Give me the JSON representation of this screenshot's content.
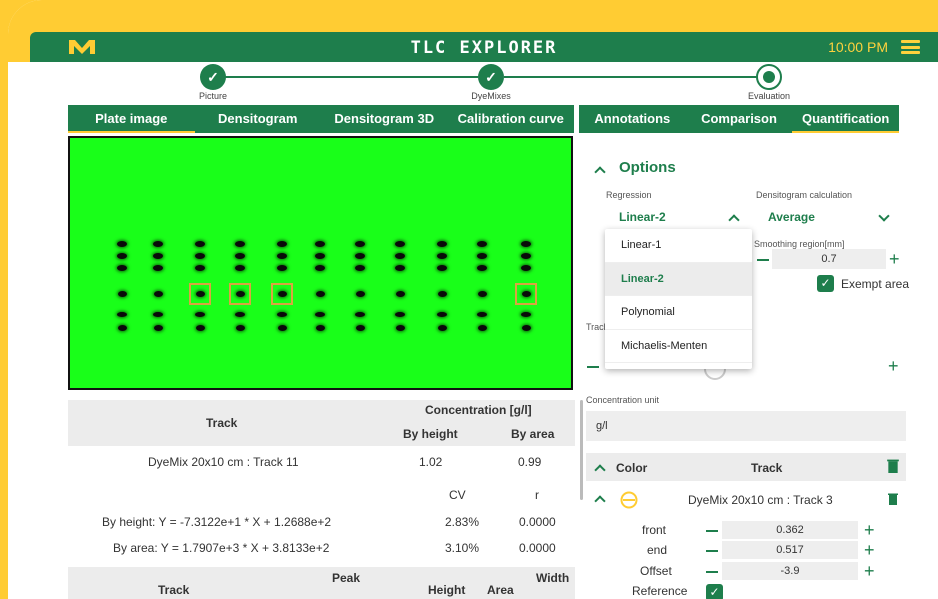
{
  "app": {
    "title": "TLC EXPLORER",
    "time": "10:00 PM"
  },
  "stepper": [
    {
      "label": "Picture",
      "state": "done"
    },
    {
      "label": "DyeMixes",
      "state": "done"
    },
    {
      "label": "Evaluation",
      "state": "current"
    }
  ],
  "left_tabs": [
    "Plate image",
    "Densitogram",
    "Densitogram 3D",
    "Calibration curve"
  ],
  "right_tabs": [
    "Annotations",
    "Comparison",
    "Quantification"
  ],
  "conc_table": {
    "track_header": "Track",
    "conc_header": "Concentration [g/l]",
    "by_height": "By height",
    "by_area": "By area",
    "row_track": "DyeMix 20x10 cm : Track 11",
    "row_by_height": "1.02",
    "row_by_area": "0.99",
    "cv_header": "CV",
    "r_header": "r",
    "height_formula": "By height:  Y = -7.3122e+1 * X + 1.2688e+2",
    "height_cv": "2.83%",
    "height_r": "0.0000",
    "area_formula": "By area:  Y = 1.7907e+3 * X + 3.8133e+2",
    "area_cv": "3.10%",
    "area_r": "0.0000"
  },
  "peak_table": {
    "track": "Track",
    "peak": "Peak",
    "height": "Height",
    "area": "Area",
    "width": "Width"
  },
  "options": {
    "title": "Options",
    "regression_label": "Regression",
    "regression_value": "Linear-2",
    "regression_options": [
      "Linear-1",
      "Linear-2",
      "Polynomial",
      "Michaelis-Menten"
    ],
    "densitogram_label": "Densitogram calculation",
    "densitogram_value": "Average",
    "smoothing_label": "Smoothing region[mm]",
    "smoothing_value": "0.7",
    "exempt_label": "Exempt area",
    "track_label_partial": "Track",
    "conc_unit_label": "Concentration unit",
    "conc_unit_value": "g/l"
  },
  "color_table": {
    "color_header": "Color",
    "track_header": "Track",
    "row_track": "DyeMix 20x10 cm : Track 3",
    "front_label": "front",
    "front_value": "0.362",
    "end_label": "end",
    "end_value": "0.517",
    "offset_label": "Offset",
    "offset_value": "-3.9",
    "reference_label": "Reference"
  },
  "colors": {
    "primary": "#1e7e4c",
    "accent": "#ffcc33",
    "plate": "#19ff19"
  }
}
